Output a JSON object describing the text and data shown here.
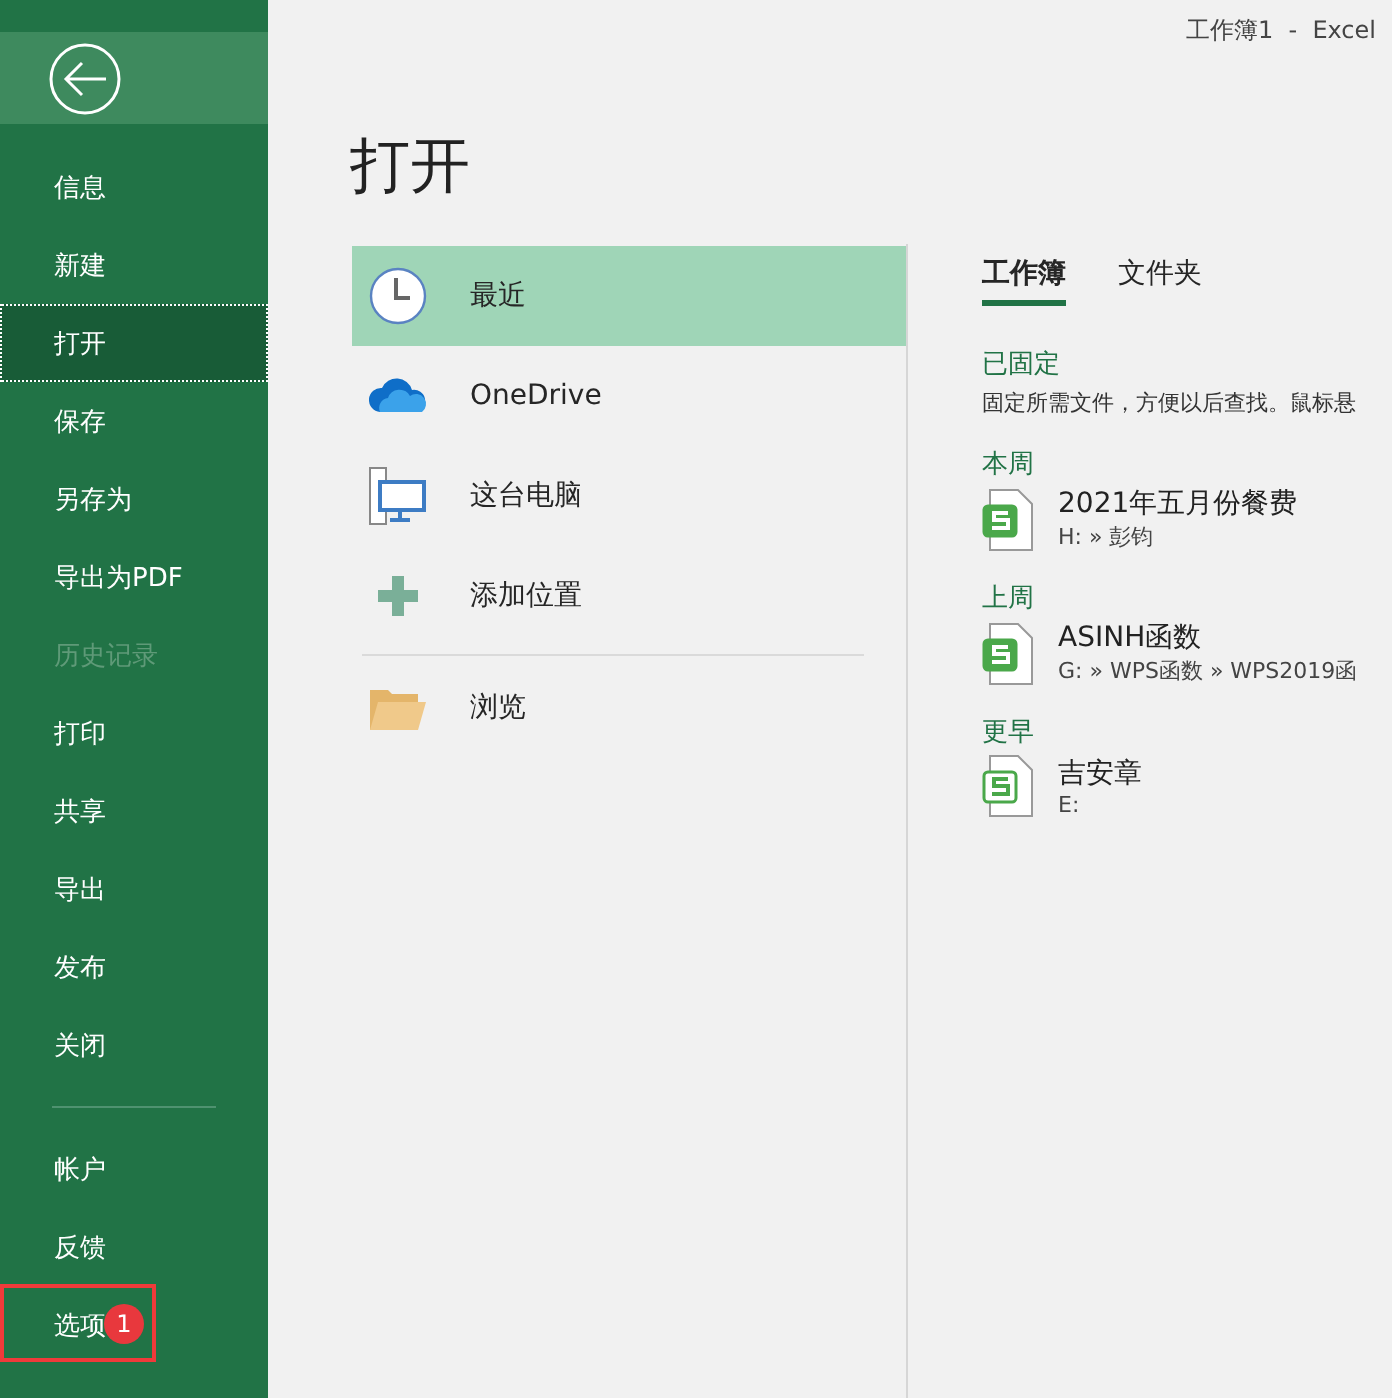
{
  "window": {
    "title": "工作簿1  -  Excel"
  },
  "sidebar": {
    "items": [
      {
        "label": "信息",
        "selected": false,
        "disabled": false
      },
      {
        "label": "新建",
        "selected": false,
        "disabled": false
      },
      {
        "label": "打开",
        "selected": true,
        "disabled": false
      },
      {
        "label": "保存",
        "selected": false,
        "disabled": false
      },
      {
        "label": "另存为",
        "selected": false,
        "disabled": false
      },
      {
        "label": "导出为PDF",
        "selected": false,
        "disabled": false
      },
      {
        "label": "历史记录",
        "selected": false,
        "disabled": true
      },
      {
        "label": "打印",
        "selected": false,
        "disabled": false
      },
      {
        "label": "共享",
        "selected": false,
        "disabled": false
      },
      {
        "label": "导出",
        "selected": false,
        "disabled": false
      },
      {
        "label": "发布",
        "selected": false,
        "disabled": false
      },
      {
        "label": "关闭",
        "selected": false,
        "disabled": false
      }
    ],
    "footer_items": [
      {
        "label": "帐户",
        "selected": false
      },
      {
        "label": "反馈",
        "selected": false
      },
      {
        "label": "选项",
        "selected": false,
        "badge": "1"
      }
    ]
  },
  "heading": "打开",
  "locations": [
    {
      "kind": "recent",
      "label": "最近",
      "selected": true
    },
    {
      "kind": "onedrive",
      "label": "OneDrive",
      "selected": false
    },
    {
      "kind": "computer",
      "label": "这台电脑",
      "selected": false
    },
    {
      "kind": "add",
      "label": "添加位置",
      "selected": false
    },
    {
      "kind": "browse",
      "label": "浏览",
      "selected": false
    }
  ],
  "tabs": [
    {
      "label": "工作簿",
      "selected": true
    },
    {
      "label": "文件夹",
      "selected": false
    }
  ],
  "pinned": {
    "title": "已固定",
    "description": "固定所需文件，方便以后查找。鼠标悬"
  },
  "groups": [
    {
      "title": "本周",
      "files": [
        {
          "name": "2021年五月份餐费",
          "path": "H: » 彭钧",
          "kind": "filled"
        }
      ]
    },
    {
      "title": "上周",
      "files": [
        {
          "name": "ASINH函数",
          "path": "G: » WPS函数 » WPS2019函",
          "kind": "filled"
        }
      ]
    },
    {
      "title": "更早",
      "files": [
        {
          "name": "吉安章",
          "path": "E:",
          "kind": "outline"
        }
      ]
    }
  ]
}
